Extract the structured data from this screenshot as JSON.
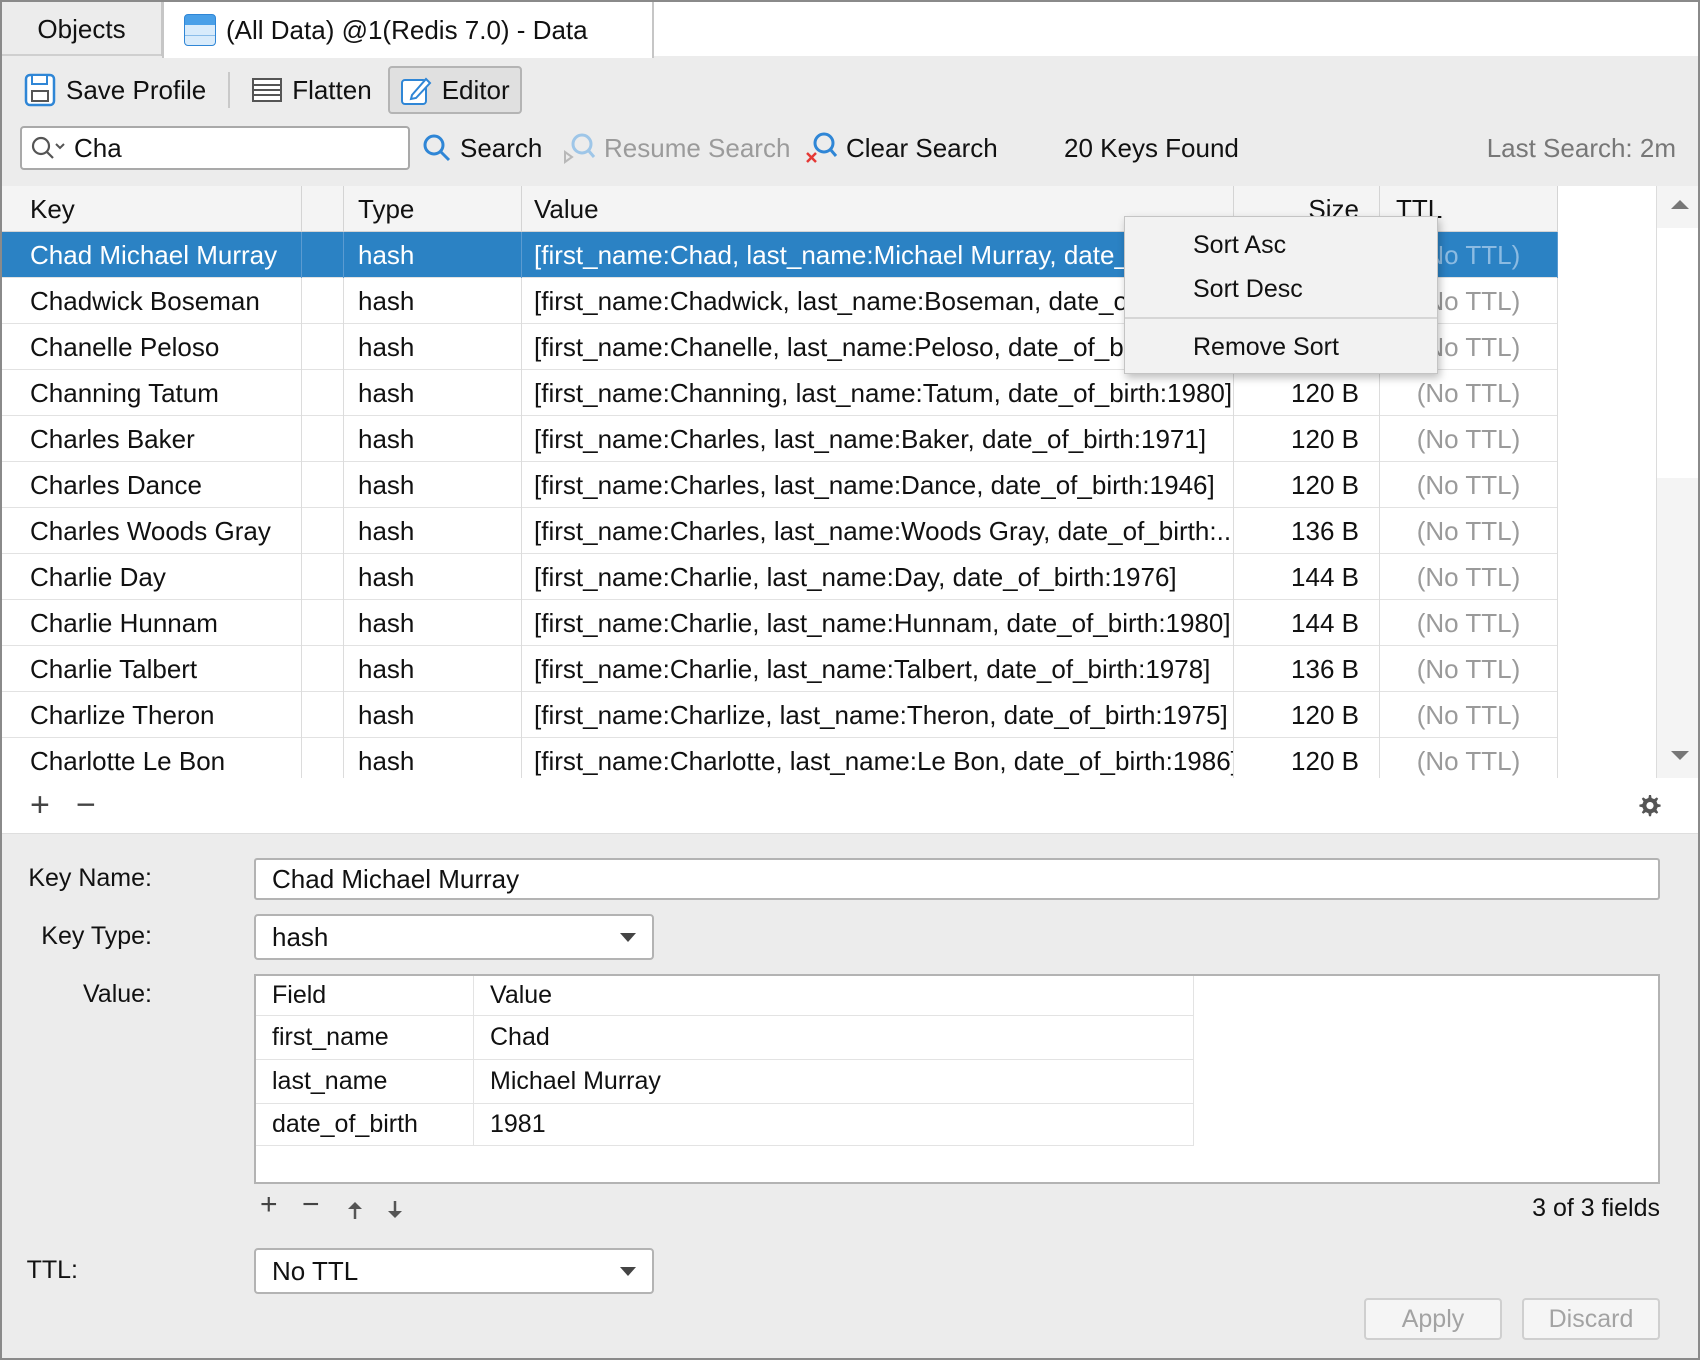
{
  "tabs": {
    "objects_label": "Objects",
    "data_label": "(All Data) @1(Redis 7.0) - Data"
  },
  "toolbar": {
    "save_profile": "Save Profile",
    "flatten": "Flatten",
    "editor": "Editor"
  },
  "search": {
    "value": "Cha",
    "search_label": "Search",
    "resume_label": "Resume Search",
    "clear_label": "Clear Search",
    "found_text": "20 Keys Found",
    "last_search": "Last Search: 2m"
  },
  "table": {
    "columns": {
      "key": "Key",
      "type": "Type",
      "value": "Value",
      "size": "Size",
      "ttl": "TTL"
    },
    "rows": [
      {
        "key": "Chad Michael Murray",
        "type": "hash",
        "value": "[first_name:Chad, last_name:Michael Murray, date_of_birth:1981]",
        "size": "",
        "ttl": "(No TTL)"
      },
      {
        "key": "Chadwick Boseman",
        "type": "hash",
        "value": "[first_name:Chadwick, last_name:Boseman, date_of_birth:1976]",
        "size": "",
        "ttl": "(No TTL)"
      },
      {
        "key": "Chanelle Peloso",
        "type": "hash",
        "value": "[first_name:Chanelle, last_name:Peloso, date_of_birth:1994]",
        "size": "",
        "ttl": "(No TTL)"
      },
      {
        "key": "Channing Tatum",
        "type": "hash",
        "value": "[first_name:Channing, last_name:Tatum, date_of_birth:1980]",
        "size": "120 B",
        "ttl": "(No TTL)"
      },
      {
        "key": "Charles Baker",
        "type": "hash",
        "value": "[first_name:Charles, last_name:Baker, date_of_birth:1971]",
        "size": "120 B",
        "ttl": "(No TTL)"
      },
      {
        "key": "Charles Dance",
        "type": "hash",
        "value": "[first_name:Charles, last_name:Dance, date_of_birth:1946]",
        "size": "120 B",
        "ttl": "(No TTL)"
      },
      {
        "key": "Charles Woods Gray",
        "type": "hash",
        "value": "[first_name:Charles, last_name:Woods Gray, date_of_birth:...",
        "size": "136 B",
        "ttl": "(No TTL)"
      },
      {
        "key": "Charlie Day",
        "type": "hash",
        "value": "[first_name:Charlie, last_name:Day, date_of_birth:1976]",
        "size": "144 B",
        "ttl": "(No TTL)"
      },
      {
        "key": "Charlie Hunnam",
        "type": "hash",
        "value": "[first_name:Charlie, last_name:Hunnam, date_of_birth:1980]",
        "size": "144 B",
        "ttl": "(No TTL)"
      },
      {
        "key": "Charlie Talbert",
        "type": "hash",
        "value": "[first_name:Charlie, last_name:Talbert, date_of_birth:1978]",
        "size": "136 B",
        "ttl": "(No TTL)"
      },
      {
        "key": "Charlize Theron",
        "type": "hash",
        "value": "[first_name:Charlize, last_name:Theron, date_of_birth:1975]",
        "size": "120 B",
        "ttl": "(No TTL)"
      },
      {
        "key": "Charlotte Le Bon",
        "type": "hash",
        "value": "[first_name:Charlotte, last_name:Le Bon, date_of_birth:1986]",
        "size": "120 B",
        "ttl": "(No TTL)"
      }
    ]
  },
  "context_menu": {
    "sort_asc": "Sort Asc",
    "sort_desc": "Sort Desc",
    "remove_sort": "Remove Sort"
  },
  "editor": {
    "key_name_label": "Key Name:",
    "key_name_value": "Chad Michael Murray",
    "key_type_label": "Key Type:",
    "key_type_value": "hash",
    "value_label": "Value:",
    "value_table": {
      "headers": {
        "field": "Field",
        "value": "Value"
      },
      "rows": [
        {
          "field": "first_name",
          "value": "Chad"
        },
        {
          "field": "last_name",
          "value": "Michael Murray"
        },
        {
          "field": "date_of_birth",
          "value": "1981"
        }
      ]
    },
    "fields_count": "3 of 3 fields",
    "ttl_label": "TTL:",
    "ttl_value": "No TTL",
    "apply_label": "Apply",
    "discard_label": "Discard"
  },
  "colors": {
    "selection": "#2b82c4",
    "accent_icon": "#2f86d6",
    "clear_x": "#e53935"
  }
}
